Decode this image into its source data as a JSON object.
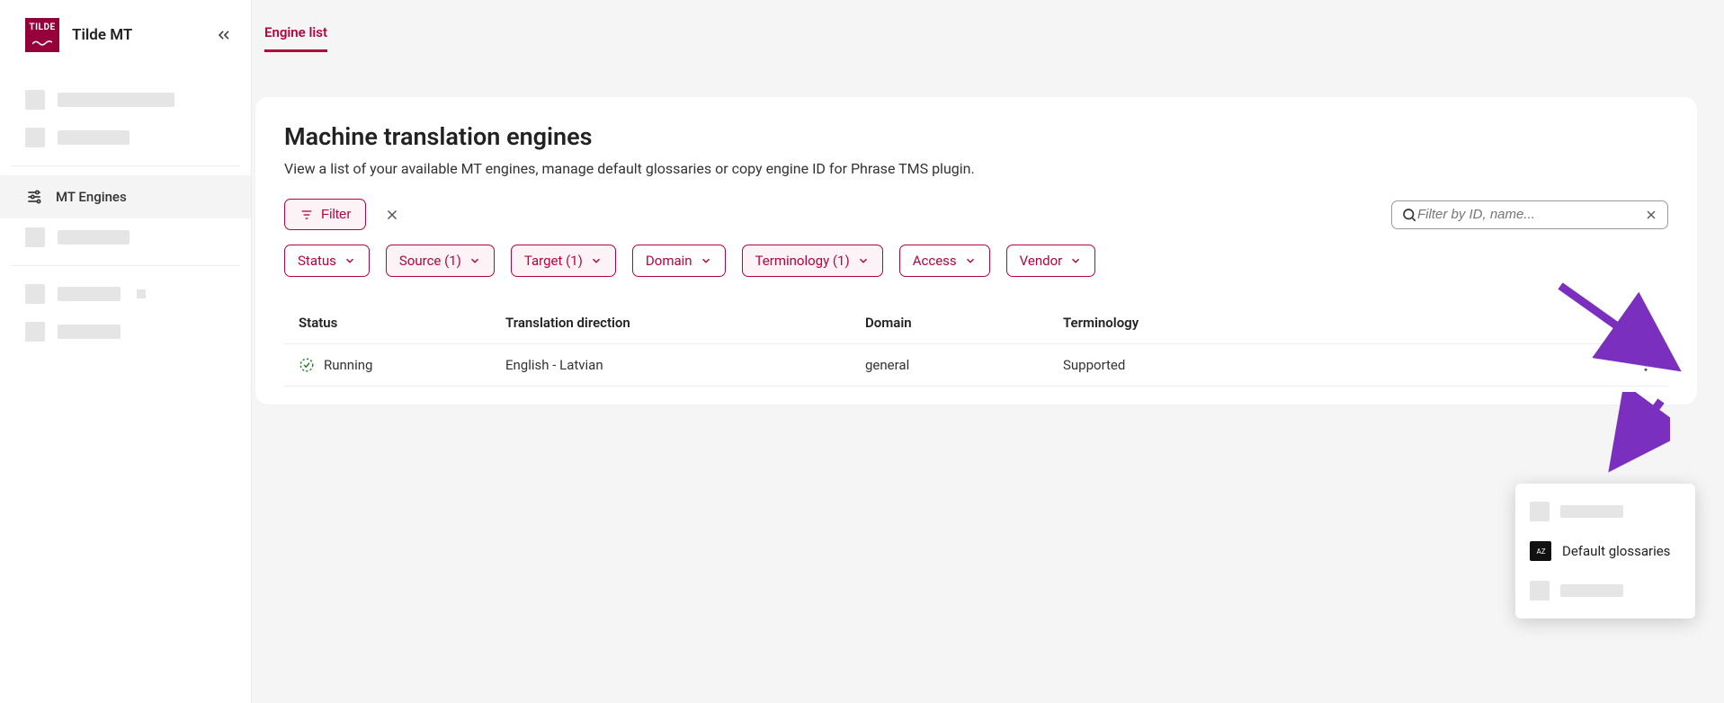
{
  "brand": {
    "name": "Tilde MT",
    "logo_text": "TILDE"
  },
  "sidebar": {
    "active_item_label": "MT Engines"
  },
  "tabs": {
    "engine_list": "Engine list"
  },
  "page": {
    "title": "Machine translation engines",
    "subtitle": "View a list of your available MT engines, manage default glossaries or copy engine ID for Phrase TMS plugin."
  },
  "toolbar": {
    "filter_label": "Filter",
    "search_placeholder": "Filter by ID, name..."
  },
  "filters": {
    "status": {
      "label": "Status",
      "active": false
    },
    "source": {
      "label": "Source (1)",
      "active": true
    },
    "target": {
      "label": "Target (1)",
      "active": true
    },
    "domain": {
      "label": "Domain",
      "active": false
    },
    "terminology": {
      "label": "Terminology (1)",
      "active": true
    },
    "access": {
      "label": "Access",
      "active": false
    },
    "vendor": {
      "label": "Vendor",
      "active": false
    }
  },
  "table": {
    "columns": {
      "status": "Status",
      "direction": "Translation direction",
      "domain": "Domain",
      "terminology": "Terminology"
    },
    "rows": [
      {
        "status": "Running",
        "direction": "English - Latvian",
        "domain": "general",
        "terminology": "Supported"
      }
    ]
  },
  "menu": {
    "default_glossaries": "Default glossaries"
  }
}
